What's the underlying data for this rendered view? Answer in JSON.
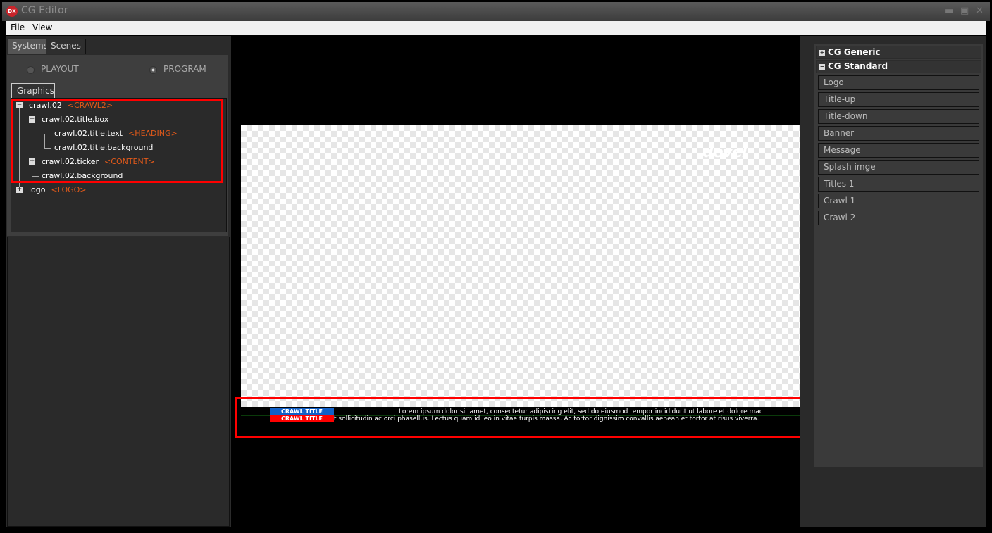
{
  "window": {
    "title": "CG Editor",
    "icon_text": "DX"
  },
  "menu": [
    "File",
    "View"
  ],
  "left": {
    "tabs": [
      "Systems",
      "Scenes"
    ],
    "radios": [
      {
        "label": "PLAYOUT",
        "selected": false
      },
      {
        "label": "PROGRAM",
        "selected": true
      }
    ],
    "graphics_tab": "Graphics",
    "tree": [
      {
        "label": "crawl.02",
        "tag": "<CRAWL2>",
        "expander": "−"
      },
      {
        "label": "crawl.02.title.box",
        "tag": "",
        "expander": "−"
      },
      {
        "label": "crawl.02.title.text",
        "tag": "<HEADING>",
        "expander": ""
      },
      {
        "label": "crawl.02.title.background",
        "tag": "",
        "expander": ""
      },
      {
        "label": "crawl.02.ticker",
        "tag": "<CONTENT>",
        "expander": "+"
      },
      {
        "label": "crawl.02.background",
        "tag": "",
        "expander": ""
      },
      {
        "label": "logo",
        "tag": "<LOGO>",
        "expander": "+"
      }
    ]
  },
  "preview": {
    "logo_text": "devel",
    "crawl_title_1": "CRAWL TITLE",
    "crawl_title_2": "CRAWL TITLE",
    "crawl_line_1": "Lorem ipsum dolor sit amet, consectetur adipiscing elit, sed do eiusmod tempor incididunt ut labore et dolore mac",
    "crawl_line_2": "t sollicitudin ac orci phasellus. Lectus quam id leo in vitae turpis massa. Ac tortor dignissim convallis aenean et tortor at risus viverra.",
    "colors": {
      "title_1_bg": "#1060c8",
      "title_2_bg": "#ff0000",
      "highlight": "#ff0000"
    }
  },
  "right": {
    "groups": [
      {
        "label": "CG Generic",
        "expander": "+"
      },
      {
        "label": "CG Standard",
        "expander": "−"
      }
    ],
    "items": [
      "Logo",
      "Title-up",
      "Title-down",
      "Banner",
      "Message",
      "Splash imge",
      "Titles 1",
      "Crawl 1",
      "Crawl 2"
    ]
  }
}
